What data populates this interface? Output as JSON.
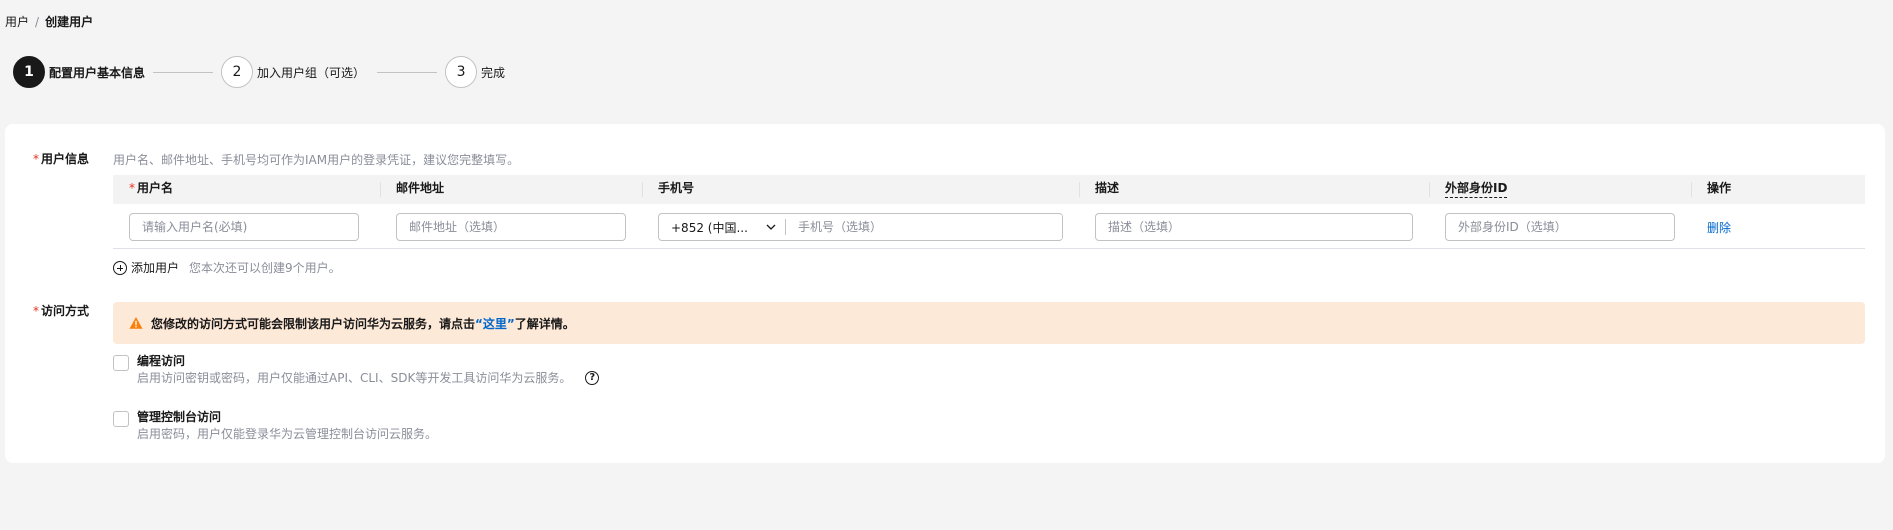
{
  "breadcrumb": {
    "parent": "用户",
    "separator": "/",
    "current": "创建用户"
  },
  "steps": [
    {
      "number": "1",
      "label": "配置用户基本信息",
      "active": true
    },
    {
      "number": "2",
      "label": "加入用户组（可选）",
      "active": false
    },
    {
      "number": "3",
      "label": "完成",
      "active": false
    }
  ],
  "user_info": {
    "label": "用户信息",
    "hint": "用户名、邮件地址、手机号均可作为IAM用户的登录凭证，建议您完整填写。",
    "columns": {
      "username": "用户名",
      "email": "邮件地址",
      "phone": "手机号",
      "description": "描述",
      "external_id": "外部身份ID",
      "action": "操作"
    },
    "row": {
      "username_placeholder": "请输入用户名(必填)",
      "email_placeholder": "邮件地址（选填）",
      "country_code": "+852 (中国...",
      "phone_placeholder": "手机号（选填）",
      "description_placeholder": "描述（选填）",
      "external_id_placeholder": "外部身份ID（选填）",
      "delete_label": "删除"
    },
    "add_user_label": "添加用户",
    "add_user_hint": "您本次还可以创建9个用户。"
  },
  "access": {
    "label": "访问方式",
    "alert": {
      "prefix": "您修改的访问方式可能会限制该用户访问华为云服务，请点击",
      "link": "“这里”",
      "suffix": "了解详情。"
    },
    "options": [
      {
        "title": "编程访问",
        "desc": "启用访问密钥或密码，用户仅能通过API、CLI、SDK等开发工具访问华为云服务。"
      },
      {
        "title": "管理控制台访问",
        "desc": "启用密码，用户仅能登录华为云管理控制台访问云服务。"
      }
    ]
  },
  "colors": {
    "accent": "#0066cc",
    "required": "#e6321e",
    "alert_bg": "#fde9d7",
    "warning": "#fa7f0a"
  }
}
